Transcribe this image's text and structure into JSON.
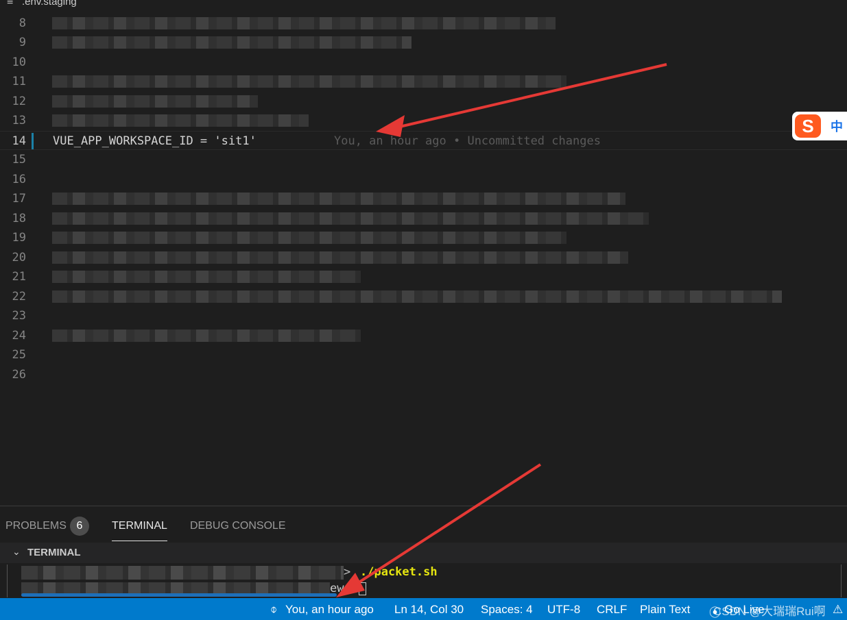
{
  "editor": {
    "file_name": ".env.staging",
    "file_icon": "menu-lines-icon",
    "line_numbers": [
      "8",
      "9",
      "10",
      "11",
      "12",
      "13",
      "14",
      "15",
      "16",
      "17",
      "18",
      "19",
      "20",
      "21",
      "22",
      "23",
      "24",
      "25",
      "26"
    ],
    "active_line": "14",
    "active_line_code": "VUE_APP_WORKSPACE_ID = 'sit1'",
    "blame_annotation": "You, an hour ago • Uncommitted changes"
  },
  "ime": {
    "logo": "S",
    "mode": "中"
  },
  "panel": {
    "tabs": [
      {
        "label": "PROBLEMS",
        "badge": "6"
      },
      {
        "label": "TERMINAL"
      },
      {
        "label": "DEBUG CONSOLE"
      }
    ],
    "terminal_title": "TERMINAL",
    "prompt_symbol": ">",
    "command": "./packet.sh",
    "prompt_fragment": "ew"
  },
  "status_bar": {
    "blame": "You, an hour ago",
    "blame_icon": "git-commit-icon",
    "position": "Ln 14, Col 30",
    "spaces": "Spaces: 4",
    "encoding": "UTF-8",
    "eol": "CRLF",
    "language": "Plain Text",
    "go_live": "Go Live",
    "watermark": "CSDN @大瑞瑞Rui啊"
  },
  "colors": {
    "status_bar": "#007acc",
    "editor_bg": "#1e1e1e",
    "arrow": "#e53935",
    "command": "#e5e510"
  }
}
